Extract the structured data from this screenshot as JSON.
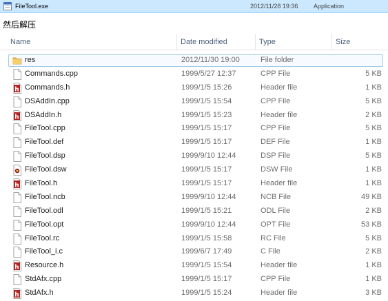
{
  "top_row": {
    "name": "FileTool.exe",
    "date": "2012/11/28 19:36",
    "type": "Application"
  },
  "caption": "然后解压",
  "columns": {
    "name": "Name",
    "date": "Date modified",
    "type": "Type",
    "size": "Size"
  },
  "files": [
    {
      "name": "res",
      "date": "2012/11/30 19:00",
      "type": "File folder",
      "size": "",
      "icon": "folder"
    },
    {
      "name": "Commands.cpp",
      "date": "1999/5/27 12:37",
      "type": "CPP File",
      "size": "5 KB",
      "icon": "file"
    },
    {
      "name": "Commands.h",
      "date": "1999/1/5 15:26",
      "type": "Header file",
      "size": "1 KB",
      "icon": "header"
    },
    {
      "name": "DSAddIn.cpp",
      "date": "1999/1/5 15:54",
      "type": "CPP File",
      "size": "5 KB",
      "icon": "file"
    },
    {
      "name": "DSAddIn.h",
      "date": "1999/1/5 15:23",
      "type": "Header file",
      "size": "2 KB",
      "icon": "header"
    },
    {
      "name": "FileTool.cpp",
      "date": "1999/1/5 15:17",
      "type": "CPP File",
      "size": "5 KB",
      "icon": "file"
    },
    {
      "name": "FileTool.def",
      "date": "1999/1/5 15:17",
      "type": "DEF File",
      "size": "1 KB",
      "icon": "file"
    },
    {
      "name": "FileTool.dsp",
      "date": "1999/9/10 12:44",
      "type": "DSP File",
      "size": "5 KB",
      "icon": "file"
    },
    {
      "name": "FileTool.dsw",
      "date": "1999/1/5 15:17",
      "type": "DSW File",
      "size": "1 KB",
      "icon": "dsw"
    },
    {
      "name": "FileTool.h",
      "date": "1999/1/5 15:17",
      "type": "Header file",
      "size": "1 KB",
      "icon": "header"
    },
    {
      "name": "FileTool.ncb",
      "date": "1999/9/10 12:44",
      "type": "NCB File",
      "size": "49 KB",
      "icon": "file"
    },
    {
      "name": "FileTool.odl",
      "date": "1999/1/5 15:21",
      "type": "ODL File",
      "size": "2 KB",
      "icon": "file"
    },
    {
      "name": "FileTool.opt",
      "date": "1999/9/10 12:44",
      "type": "OPT File",
      "size": "53 KB",
      "icon": "file"
    },
    {
      "name": "FileTool.rc",
      "date": "1999/1/5 15:58",
      "type": "RC File",
      "size": "5 KB",
      "icon": "file"
    },
    {
      "name": "FileTool_i.c",
      "date": "1999/6/7 17:49",
      "type": "C File",
      "size": "2 KB",
      "icon": "file"
    },
    {
      "name": "Resource.h",
      "date": "1999/1/5 15:54",
      "type": "Header file",
      "size": "1 KB",
      "icon": "header"
    },
    {
      "name": "StdAfx.cpp",
      "date": "1999/1/5 15:17",
      "type": "CPP File",
      "size": "1 KB",
      "icon": "file"
    },
    {
      "name": "StdAfx.h",
      "date": "1999/1/5 15:24",
      "type": "Header file",
      "size": "3 KB",
      "icon": "header"
    }
  ],
  "selected_index": 0,
  "colors": {
    "selection_fill": "#cce8ff",
    "header_text": "#4c607a",
    "folder": "#e8b94a",
    "header_icon": "#b22222"
  }
}
